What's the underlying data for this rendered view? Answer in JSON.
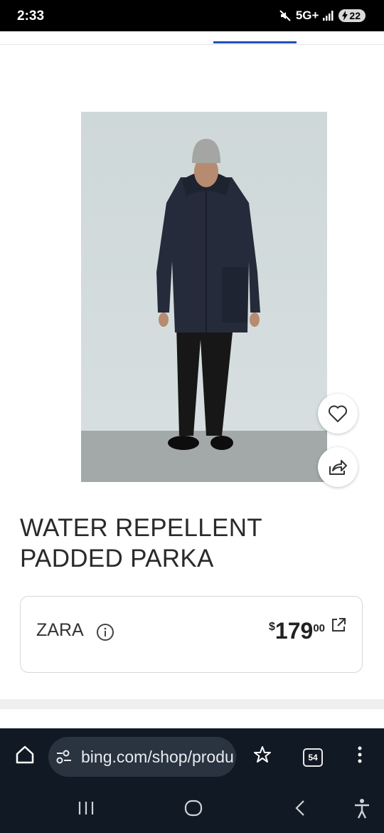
{
  "status_bar": {
    "time": "2:33",
    "network": "5G+",
    "battery": "22"
  },
  "product": {
    "image_alt": "Man wearing a navy padded parka, grey beanie and black trousers against a light grey wall",
    "title_line1": "WATER REPELLENT",
    "title_line2": "PADDED PARKA",
    "actions": [
      "heart-icon",
      "share-icon"
    ]
  },
  "seller": {
    "name": "ZARA",
    "price_currency": "$",
    "price_main": "179",
    "price_cents": "00"
  },
  "browser": {
    "url": "bing.com/shop/produ",
    "tab_count": "54"
  },
  "colors": {
    "accent": "#1f4fb8",
    "browser_bg": "#111a24",
    "url_pill_bg": "#2a3340"
  }
}
